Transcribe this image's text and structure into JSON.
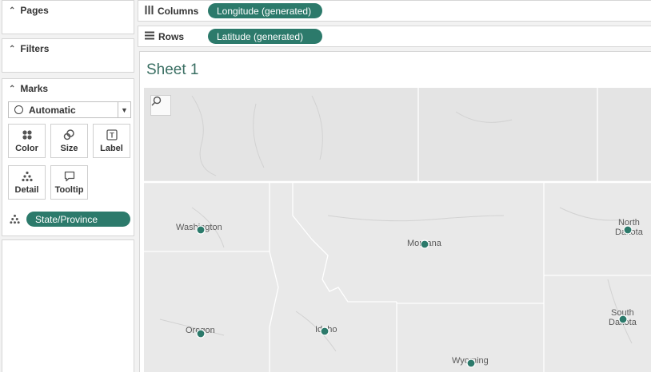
{
  "panes": {
    "pages": "Pages",
    "filters": "Filters",
    "marks": "Marks"
  },
  "marks": {
    "type": "Automatic",
    "buttons": [
      "Color",
      "Size",
      "Label",
      "Detail",
      "Tooltip"
    ],
    "detail_pill": "State/Province"
  },
  "shelves": {
    "columns_label": "Columns",
    "columns_pill": "Longitude (generated)",
    "rows_label": "Rows",
    "rows_pill": "Latitude (generated)"
  },
  "sheet": {
    "title": "Sheet 1"
  },
  "map": {
    "mark_color": "#2c7a6b",
    "states": [
      {
        "label": "Washington",
        "lines": [
          "Washington"
        ]
      },
      {
        "label": "Montana",
        "lines": [
          "Montana"
        ]
      },
      {
        "label": "North Dakota",
        "lines": [
          "North",
          "Dakota"
        ]
      },
      {
        "label": "South Dakota",
        "lines": [
          "South",
          "Dakota"
        ]
      },
      {
        "label": "Oregon",
        "lines": [
          "Oregon"
        ]
      },
      {
        "label": "Idaho",
        "lines": [
          "Idaho"
        ]
      },
      {
        "label": "Wyoming",
        "lines": [
          "Wyoming"
        ]
      }
    ]
  }
}
